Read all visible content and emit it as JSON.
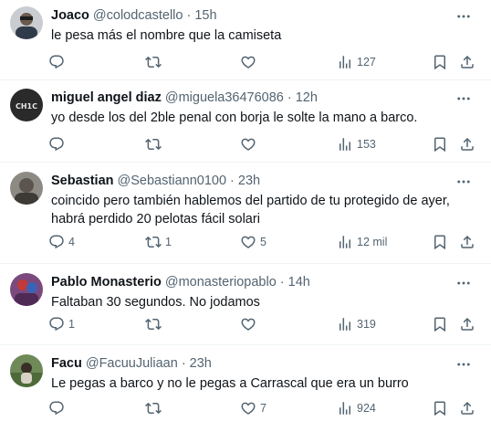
{
  "tweets": [
    {
      "name": "Joaco",
      "handle": "@colodcastello",
      "time": "15h",
      "text": "le pesa más el nombre que la camiseta",
      "replies": "",
      "retweets": "",
      "likes": "",
      "views": "127"
    },
    {
      "name": "miguel angel diaz",
      "handle": "@miguela36476086",
      "time": "12h",
      "text": "yo desde los del 2ble penal con borja le solte la mano a barco.",
      "replies": "",
      "retweets": "",
      "likes": "",
      "views": "153",
      "avatar_text": "CH1C"
    },
    {
      "name": "Sebastian",
      "handle": "@Sebastiann0100",
      "time": "23h",
      "text": "coincido pero también hablemos del partido de tu protegido de ayer, habrá perdido 20 pelotas fácil solari",
      "replies": "4",
      "retweets": "1",
      "likes": "5",
      "views": "12 mil"
    },
    {
      "name": "Pablo Monasterio",
      "handle": "@monasteriopablo",
      "time": "14h",
      "text": "Faltaban 30 segundos. No jodamos",
      "replies": "1",
      "retweets": "",
      "likes": "",
      "views": "319"
    },
    {
      "name": "Facu",
      "handle": "@FacuuJuliaan",
      "time": "23h",
      "text": "Le pegas a barco y no le pegas a Carrascal que era un burro",
      "replies": "",
      "retweets": "",
      "likes": "7",
      "views": "924"
    }
  ],
  "separator": "·",
  "colors": {
    "text": "#0f1419",
    "muted": "#536471",
    "border": "#eff3f4"
  },
  "icons": [
    "more-icon",
    "reply-icon",
    "retweet-icon",
    "like-icon",
    "views-icon",
    "bookmark-icon",
    "share-icon"
  ]
}
